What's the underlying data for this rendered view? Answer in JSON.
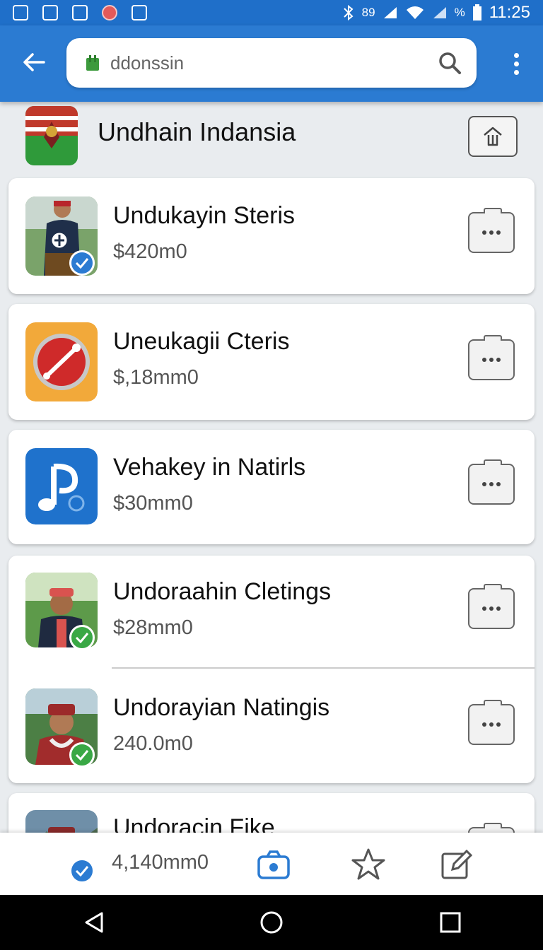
{
  "status_bar": {
    "network_text": "89",
    "battery_text": "%",
    "time": "11:25"
  },
  "app_bar": {
    "search_value": "ddonssin",
    "back_icon": "arrow-left-icon",
    "search_icon": "search-icon",
    "menu_icon": "more-vertical-icon"
  },
  "header": {
    "title": "Undhain Indansia",
    "action_icon": "upload-icon"
  },
  "items": [
    {
      "name": "Undukayin Steris",
      "price": "$420m0",
      "badge": "check-blue"
    },
    {
      "name": "Uneukagii Cteris",
      "price": "$,18mm0",
      "badge": "none"
    },
    {
      "name": "Vehakey in Natirls",
      "price": "$30mm0",
      "badge": "none"
    },
    {
      "name": "Undoraahin Cletings",
      "price": "$28mm0",
      "badge": "check-green"
    },
    {
      "name": "Undorayian Natingis",
      "price": "240.0m0",
      "badge": "check-green"
    },
    {
      "name": "Undoracin Fike",
      "price": "4,140mm0",
      "badge": "check-blue"
    }
  ],
  "tab_bar": {
    "icons": [
      "camera-icon",
      "star-icon",
      "edit-icon"
    ]
  },
  "colors": {
    "primary": "#2b7bd2",
    "status_bar": "#1f6fc9",
    "badge_green": "#39a845",
    "background": "#e9ecef"
  }
}
